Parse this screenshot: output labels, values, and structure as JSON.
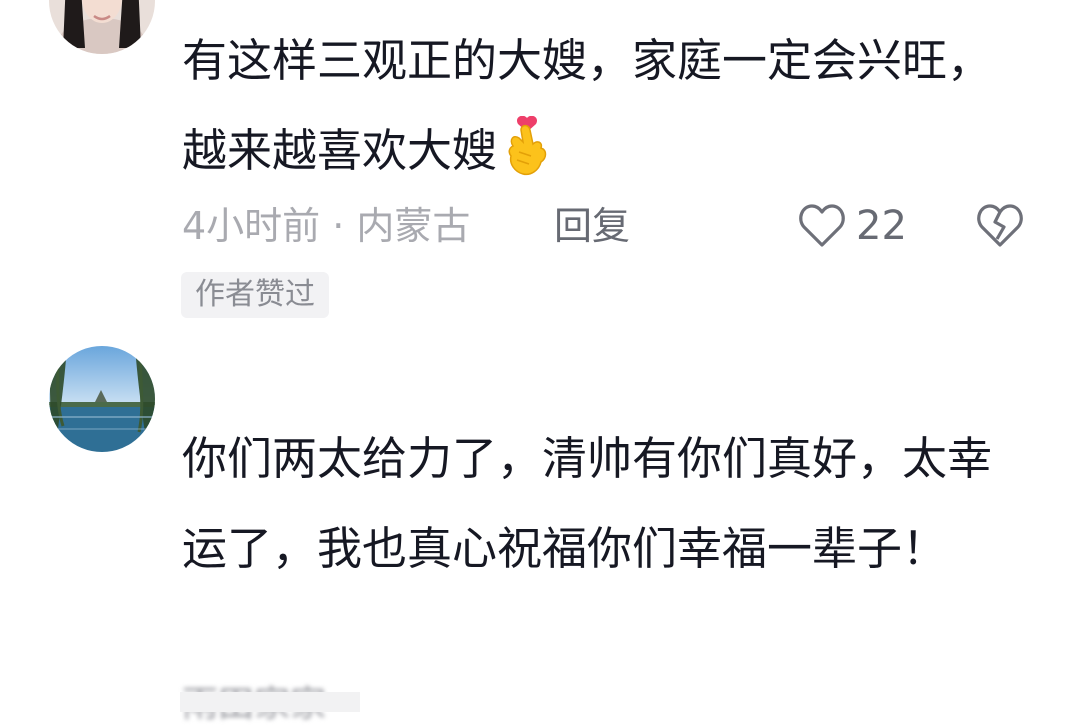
{
  "comments": [
    {
      "avatar_icon": "user-avatar-woman-photo",
      "text": "有这样三观正的大嫂，家庭一定会兴旺，越来越喜欢大嫂",
      "emoji_icon": "finger-heart-emoji",
      "time_location": "4小时前 · 内蒙古",
      "reply_label": "回复",
      "like_icon": "heart-outline-icon",
      "like_count": "22",
      "dislike_icon": "broken-heart-icon",
      "badge": "作者赞过"
    },
    {
      "avatar_icon": "user-avatar-lake-willow-photo",
      "username": "雨田家家",
      "text": "你们两太给力了，清帅有你们真好，太幸运了，我也真心祝福你们幸福一辈子！"
    }
  ],
  "colors": {
    "text": "#161823",
    "meta": "#a9aab0",
    "action": "#676a73",
    "badge_bg": "#f2f2f4"
  }
}
